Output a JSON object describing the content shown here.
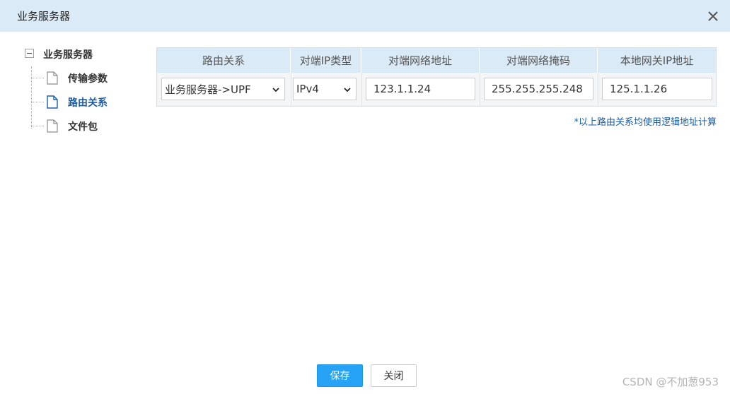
{
  "dialog": {
    "title": "业务服务器",
    "close_icon": "close-icon"
  },
  "tree": {
    "root_label": "业务服务器",
    "items": [
      {
        "label": "传输参数",
        "icon": "document-icon",
        "active": false
      },
      {
        "label": "路由关系",
        "icon": "document-icon",
        "active": true
      },
      {
        "label": "文件包",
        "icon": "document-icon",
        "active": false
      }
    ]
  },
  "table": {
    "headers": [
      "路由关系",
      "对端IP类型",
      "对端网络地址",
      "对端网络掩码",
      "本地网关IP地址"
    ],
    "row": {
      "route": "业务服务器->UPF",
      "ip_type": "IPv4",
      "peer_network_address": "123.1.1.24",
      "peer_network_mask": "255.255.255.248",
      "local_gateway_ip": "125.1.1.26"
    }
  },
  "note": "*以上路由关系均使用逻辑地址计算",
  "buttons": {
    "save": "保存",
    "close": "关闭"
  },
  "watermark": "CSDN @不加葱953",
  "colors": {
    "titlebar": "#dbeaf7",
    "accent": "#1a5ea8",
    "primary_button": "#27a3f5"
  }
}
